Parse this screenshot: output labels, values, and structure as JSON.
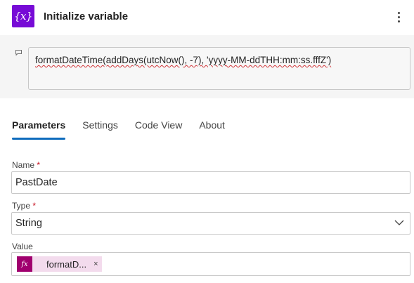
{
  "header": {
    "title": "Initialize variable",
    "icon": "variable-braces-icon",
    "icon_glyph": "{x}",
    "accent_color": "#770bd6"
  },
  "expression": {
    "text": "formatDateTime(addDays(utcNow(), -7), 'yyyy-MM-ddTHH:mm:ss.fffZ')"
  },
  "tabs": [
    {
      "label": "Parameters",
      "active": true
    },
    {
      "label": "Settings",
      "active": false
    },
    {
      "label": "Code View",
      "active": false
    },
    {
      "label": "About",
      "active": false
    }
  ],
  "fields": {
    "name": {
      "label": "Name",
      "required_mark": "*",
      "value": "PastDate"
    },
    "type": {
      "label": "Type",
      "required_mark": "*",
      "value": "String"
    },
    "value": {
      "label": "Value",
      "token": {
        "icon_glyph": "fx",
        "label": "formatD...",
        "close": "×",
        "color": "#a0006e"
      }
    }
  },
  "colors": {
    "tab_indicator": "#0f6cbd",
    "required": "#c50f1f",
    "spellcheck": "#d13438"
  }
}
